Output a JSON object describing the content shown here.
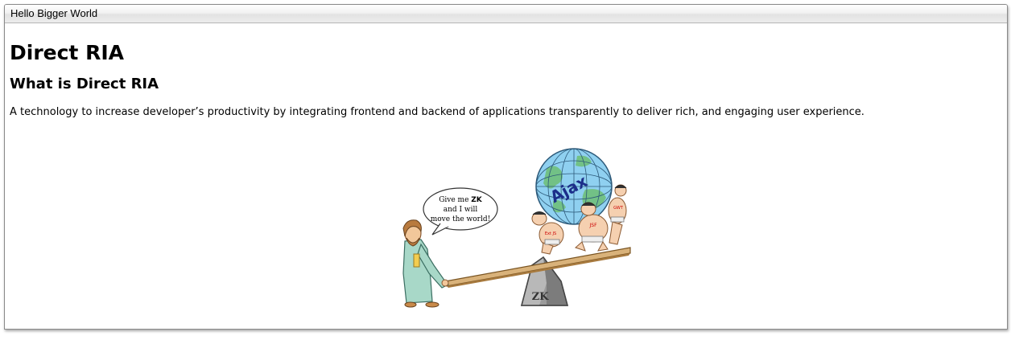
{
  "window": {
    "title": "Hello Bigger World"
  },
  "main": {
    "heading": "Direct RIA",
    "subheading": "What is Direct RIA",
    "description": "A technology to increase developer’s productivity by integrating frontend and backend of applications transparently to deliver rich, and engaging user experience."
  },
  "illustration": {
    "speech_line1_prefix": "Give me ",
    "speech_line1_bold": "ZK",
    "speech_line2": "and I will",
    "speech_line3": "move the world!",
    "globe_label": "Ajax",
    "rock_label": "ZK",
    "sumo_labels": [
      "Ext JS",
      "JSF",
      "GWT"
    ]
  }
}
